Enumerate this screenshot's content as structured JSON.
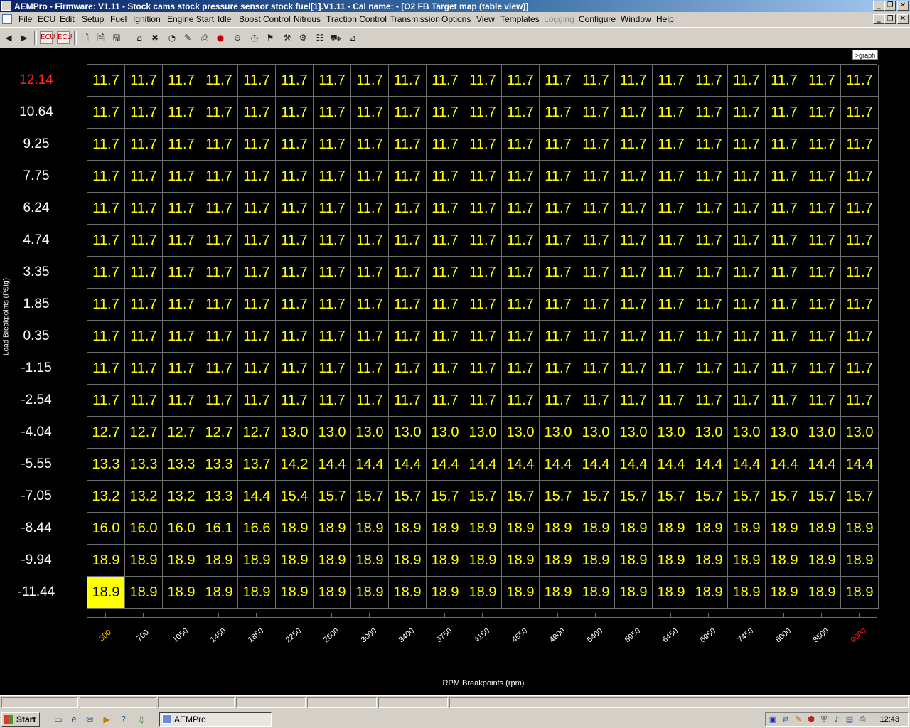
{
  "window": {
    "title": "AEMPro - Firmware: V1.11 - Stock cams stock pressure sensor stock fuel[1].V1.11 - Cal name:  - [O2 FB Target map (table view)]",
    "min_label": "_",
    "restore_label": "❐",
    "close_label": "✕"
  },
  "menu": {
    "items": [
      "File",
      "ECU",
      "Edit",
      "Setup",
      "Fuel",
      "Ignition",
      "Engine Start",
      "Idle",
      "Boost Control",
      "Nitrous",
      "Traction Control",
      "Transmission",
      "Options",
      "View",
      "Templates",
      "Logging",
      "Configure",
      "Window",
      "Help"
    ],
    "disabled": [
      "Logging"
    ]
  },
  "toolbar": {
    "icons": [
      "back-arrow-icon",
      "forward-arrow-icon",
      "ecu-connect-icon",
      "ecu-disconnect-icon",
      "new-file-icon",
      "open-file-icon",
      "save-file-icon",
      "home-icon",
      "tools-icon",
      "gauge-icon",
      "pen-icon",
      "printer-icon",
      "stop-icon",
      "dial-icon",
      "clock-icon",
      "flag-icon",
      "wrench-icon",
      "settings-icon",
      "sliders-icon",
      "car-icon",
      "graph-icon"
    ],
    "ecu_label": "ECU"
  },
  "graph_button": {
    "label": ">graph"
  },
  "table": {
    "title": "O2 FB Target map",
    "selected_cell": {
      "row": 16,
      "col": 0
    },
    "row_labels": [
      "12.14",
      "10.64",
      "9.25",
      "7.75",
      "6.24",
      "4.74",
      "3.35",
      "1.85",
      "0.35",
      "-1.15",
      "-2.54",
      "-4.04",
      "-5.55",
      "-7.05",
      "-8.44",
      "-9.94",
      "-11.44"
    ],
    "col_labels": [
      "300",
      "700",
      "1050",
      "1450",
      "1850",
      "2250",
      "2600",
      "3000",
      "3400",
      "3750",
      "4150",
      "4550",
      "4900",
      "5400",
      "5950",
      "6450",
      "6950",
      "7450",
      "8000",
      "8500",
      "9000"
    ],
    "y_axis_title": "Load Breakpoints (PSIg)",
    "x_axis_title": "RPM Breakpoints (rpm)",
    "highlight_colors": {
      "max_label": "#ff2020",
      "min_rpm_label": "#e0c000",
      "max_rpm_label": "#ff2020",
      "cell": "#ffff00",
      "label": "#ffffff"
    },
    "values": [
      [
        "11.7",
        "11.7",
        "11.7",
        "11.7",
        "11.7",
        "11.7",
        "11.7",
        "11.7",
        "11.7",
        "11.7",
        "11.7",
        "11.7",
        "11.7",
        "11.7",
        "11.7",
        "11.7",
        "11.7",
        "11.7",
        "11.7",
        "11.7",
        "11.7"
      ],
      [
        "11.7",
        "11.7",
        "11.7",
        "11.7",
        "11.7",
        "11.7",
        "11.7",
        "11.7",
        "11.7",
        "11.7",
        "11.7",
        "11.7",
        "11.7",
        "11.7",
        "11.7",
        "11.7",
        "11.7",
        "11.7",
        "11.7",
        "11.7",
        "11.7"
      ],
      [
        "11.7",
        "11.7",
        "11.7",
        "11.7",
        "11.7",
        "11.7",
        "11.7",
        "11.7",
        "11.7",
        "11.7",
        "11.7",
        "11.7",
        "11.7",
        "11.7",
        "11.7",
        "11.7",
        "11.7",
        "11.7",
        "11.7",
        "11.7",
        "11.7"
      ],
      [
        "11.7",
        "11.7",
        "11.7",
        "11.7",
        "11.7",
        "11.7",
        "11.7",
        "11.7",
        "11.7",
        "11.7",
        "11.7",
        "11.7",
        "11.7",
        "11.7",
        "11.7",
        "11.7",
        "11.7",
        "11.7",
        "11.7",
        "11.7",
        "11.7"
      ],
      [
        "11.7",
        "11.7",
        "11.7",
        "11.7",
        "11.7",
        "11.7",
        "11.7",
        "11.7",
        "11.7",
        "11.7",
        "11.7",
        "11.7",
        "11.7",
        "11.7",
        "11.7",
        "11.7",
        "11.7",
        "11.7",
        "11.7",
        "11.7",
        "11.7"
      ],
      [
        "11.7",
        "11.7",
        "11.7",
        "11.7",
        "11.7",
        "11.7",
        "11.7",
        "11.7",
        "11.7",
        "11.7",
        "11.7",
        "11.7",
        "11.7",
        "11.7",
        "11.7",
        "11.7",
        "11.7",
        "11.7",
        "11.7",
        "11.7",
        "11.7"
      ],
      [
        "11.7",
        "11.7",
        "11.7",
        "11.7",
        "11.7",
        "11.7",
        "11.7",
        "11.7",
        "11.7",
        "11.7",
        "11.7",
        "11.7",
        "11.7",
        "11.7",
        "11.7",
        "11.7",
        "11.7",
        "11.7",
        "11.7",
        "11.7",
        "11.7"
      ],
      [
        "11.7",
        "11.7",
        "11.7",
        "11.7",
        "11.7",
        "11.7",
        "11.7",
        "11.7",
        "11.7",
        "11.7",
        "11.7",
        "11.7",
        "11.7",
        "11.7",
        "11.7",
        "11.7",
        "11.7",
        "11.7",
        "11.7",
        "11.7",
        "11.7"
      ],
      [
        "11.7",
        "11.7",
        "11.7",
        "11.7",
        "11.7",
        "11.7",
        "11.7",
        "11.7",
        "11.7",
        "11.7",
        "11.7",
        "11.7",
        "11.7",
        "11.7",
        "11.7",
        "11.7",
        "11.7",
        "11.7",
        "11.7",
        "11.7",
        "11.7"
      ],
      [
        "11.7",
        "11.7",
        "11.7",
        "11.7",
        "11.7",
        "11.7",
        "11.7",
        "11.7",
        "11.7",
        "11.7",
        "11.7",
        "11.7",
        "11.7",
        "11.7",
        "11.7",
        "11.7",
        "11.7",
        "11.7",
        "11.7",
        "11.7",
        "11.7"
      ],
      [
        "11.7",
        "11.7",
        "11.7",
        "11.7",
        "11.7",
        "11.7",
        "11.7",
        "11.7",
        "11.7",
        "11.7",
        "11.7",
        "11.7",
        "11.7",
        "11.7",
        "11.7",
        "11.7",
        "11.7",
        "11.7",
        "11.7",
        "11.7",
        "11.7"
      ],
      [
        "12.7",
        "12.7",
        "12.7",
        "12.7",
        "12.7",
        "13.0",
        "13.0",
        "13.0",
        "13.0",
        "13.0",
        "13.0",
        "13.0",
        "13.0",
        "13.0",
        "13.0",
        "13.0",
        "13.0",
        "13.0",
        "13.0",
        "13.0",
        "13.0"
      ],
      [
        "13.3",
        "13.3",
        "13.3",
        "13.3",
        "13.7",
        "14.2",
        "14.4",
        "14.4",
        "14.4",
        "14.4",
        "14.4",
        "14.4",
        "14.4",
        "14.4",
        "14.4",
        "14.4",
        "14.4",
        "14.4",
        "14.4",
        "14.4",
        "14.4"
      ],
      [
        "13.2",
        "13.2",
        "13.2",
        "13.3",
        "14.4",
        "15.4",
        "15.7",
        "15.7",
        "15.7",
        "15.7",
        "15.7",
        "15.7",
        "15.7",
        "15.7",
        "15.7",
        "15.7",
        "15.7",
        "15.7",
        "15.7",
        "15.7",
        "15.7"
      ],
      [
        "16.0",
        "16.0",
        "16.0",
        "16.1",
        "16.6",
        "18.9",
        "18.9",
        "18.9",
        "18.9",
        "18.9",
        "18.9",
        "18.9",
        "18.9",
        "18.9",
        "18.9",
        "18.9",
        "18.9",
        "18.9",
        "18.9",
        "18.9",
        "18.9"
      ],
      [
        "18.9",
        "18.9",
        "18.9",
        "18.9",
        "18.9",
        "18.9",
        "18.9",
        "18.9",
        "18.9",
        "18.9",
        "18.9",
        "18.9",
        "18.9",
        "18.9",
        "18.9",
        "18.9",
        "18.9",
        "18.9",
        "18.9",
        "18.9",
        "18.9"
      ],
      [
        "18.9",
        "18.9",
        "18.9",
        "18.9",
        "18.9",
        "18.9",
        "18.9",
        "18.9",
        "18.9",
        "18.9",
        "18.9",
        "18.9",
        "18.9",
        "18.9",
        "18.9",
        "18.9",
        "18.9",
        "18.9",
        "18.9",
        "18.9",
        "18.9"
      ]
    ]
  },
  "taskbar": {
    "start_label": "Start",
    "task_label": "AEMPro",
    "clock": "12:43",
    "quick_launch": [
      "show-desktop-icon",
      "ie-icon",
      "outlook-icon",
      "media-player-icon",
      "help-icon",
      "winamp-icon"
    ],
    "tray": [
      "monitor-icon",
      "network-icon",
      "pencil-icon",
      "antivirus-icon",
      "shield-icon",
      "speaker-icon",
      "tray-app-icon",
      "printer-icon"
    ]
  }
}
